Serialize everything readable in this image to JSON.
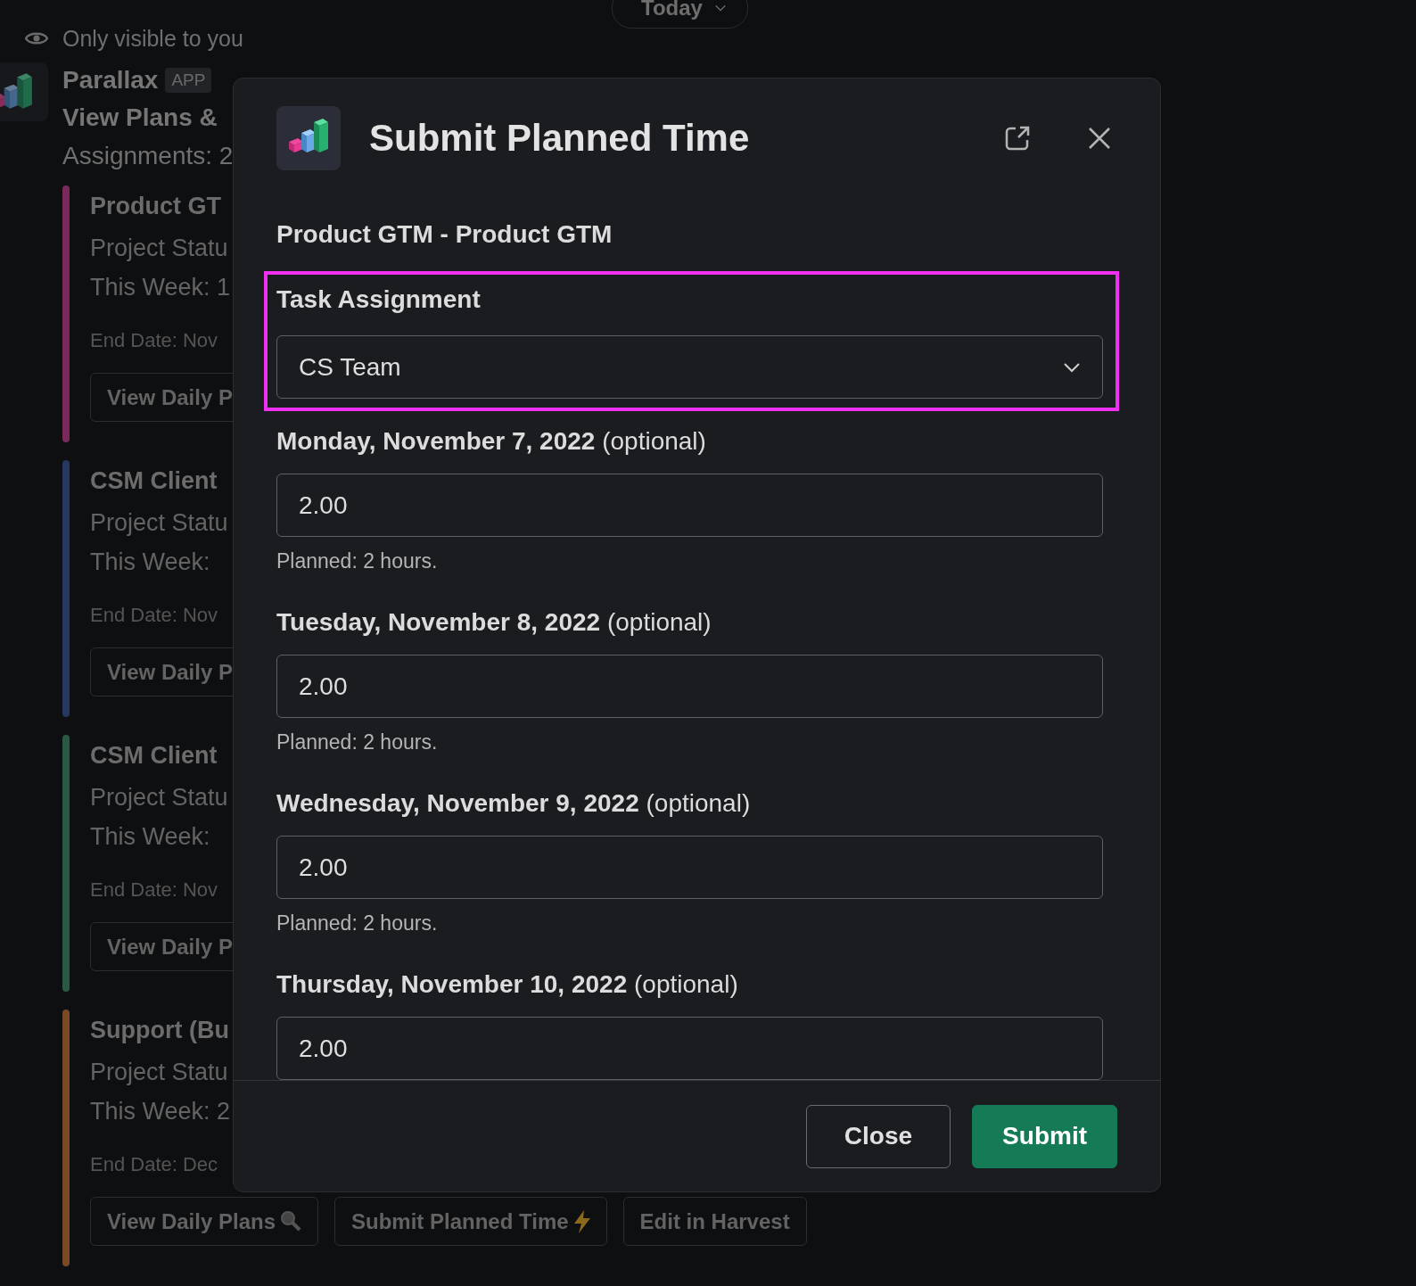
{
  "date_pill": {
    "label": "Today"
  },
  "notice": "Only visible to you",
  "message": {
    "sender": "Parallax",
    "badge": "APP",
    "title": "View Plans &",
    "subtitle": "Assignments: 2",
    "projects": [
      {
        "name": "Product GT",
        "status": "Project Statu",
        "week": "This Week: 1",
        "end_date": "End Date: Nov",
        "color": "#7a2a5a",
        "buttons": [
          {
            "label": "View Daily P"
          }
        ]
      },
      {
        "name": "CSM Client",
        "status": "Project Statu",
        "week": "This Week:",
        "end_date": "End Date: Nov",
        "color": "#27375f",
        "buttons": [
          {
            "label": "View Daily P"
          }
        ]
      },
      {
        "name": "CSM Client",
        "status": "Project Statu",
        "week": "This Week:",
        "end_date": "End Date: Nov",
        "color": "#2a5a45",
        "buttons": [
          {
            "label": "View Daily P"
          }
        ]
      },
      {
        "name": "Support (Bu",
        "status": "Project Statu",
        "week": "This Week: 2",
        "end_date": "End Date: Dec",
        "color": "#7a4a28",
        "buttons": [
          {
            "label": "View Daily Plans",
            "kind": "view"
          },
          {
            "label": "Submit Planned Time",
            "kind": "submit"
          },
          {
            "label": "Edit in Harvest",
            "kind": "edit"
          }
        ]
      }
    ]
  },
  "modal": {
    "title": "Submit Planned Time",
    "project": "Product GTM - Product GTM",
    "task_assignment": {
      "label": "Task Assignment",
      "value": "CS Team",
      "highlighted": true
    },
    "days": [
      {
        "label": "**Monday, November 7, 2022** (optional)",
        "value": "2.00",
        "hint": "Planned: 2 hours."
      },
      {
        "label": "**Tuesday, November 8, 2022** (optional)",
        "value": "2.00",
        "hint": "Planned: 2 hours."
      },
      {
        "label": "**Wednesday, November 9, 2022** (optional)",
        "value": "2.00",
        "hint": "Planned: 2 hours."
      },
      {
        "label": "**Thursday, November 10, 2022** (optional)",
        "value": "2.00"
      }
    ],
    "buttons": [
      {
        "label": "Close",
        "kind": "secondary"
      },
      {
        "label": "Submit",
        "kind": "primary"
      }
    ]
  }
}
